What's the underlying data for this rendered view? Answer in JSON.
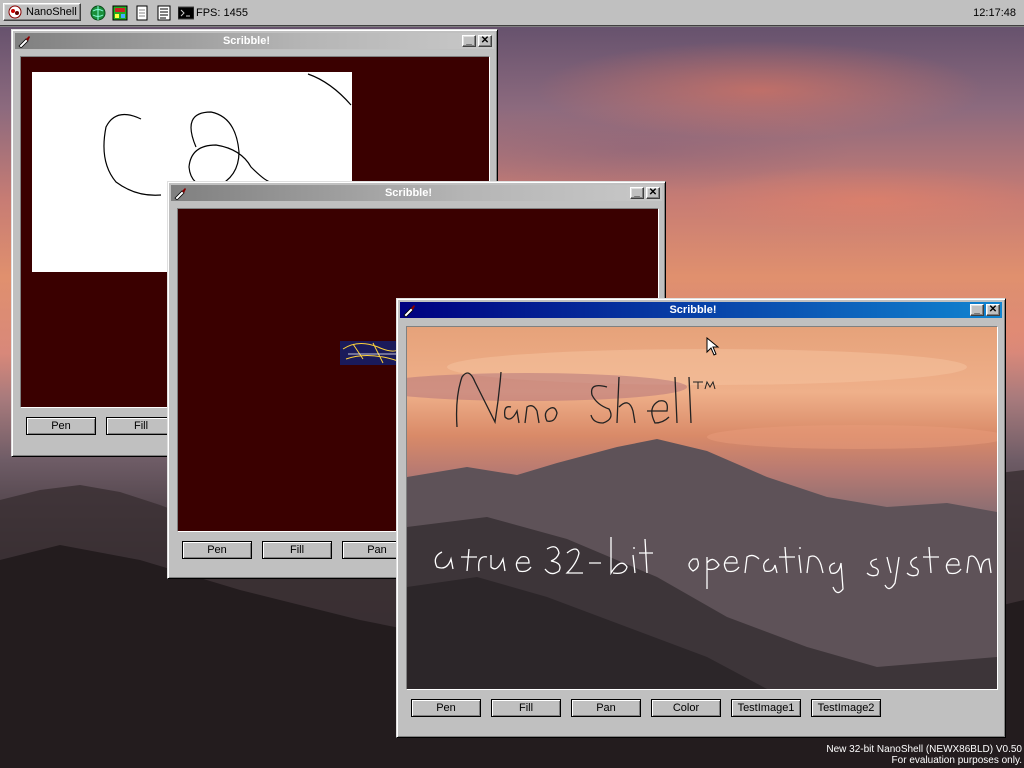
{
  "taskbar": {
    "start_label": "NanoShell",
    "fps_label": "FPS: 1455",
    "clock": "12:17:48",
    "icons": [
      "globe-icon",
      "calculator-icon",
      "notepad-icon",
      "document-icon",
      "terminal-icon"
    ]
  },
  "windows": [
    {
      "title": "Scribble!",
      "active": false,
      "buttons": [
        "Pen",
        "Fill"
      ]
    },
    {
      "title": "Scribble!",
      "active": false,
      "buttons": [
        "Pen",
        "Fill",
        "Pan"
      ]
    },
    {
      "title": "Scribble!",
      "active": true,
      "buttons": [
        "Pen",
        "Fill",
        "Pan",
        "Color",
        "TestImage1",
        "TestImage2"
      ],
      "handwriting": [
        "NanoShell™",
        "a true 32-bit operating system"
      ]
    }
  ],
  "watermark": {
    "line1": "New 32-bit NanoShell (NEWX86BLD) V0.50",
    "line2": "For evaluation purposes only."
  },
  "colors": {
    "canvas_bg": "#3a0000",
    "active_title": "#000080",
    "inactive_title": "#808080",
    "face": "#c0c0c0"
  }
}
